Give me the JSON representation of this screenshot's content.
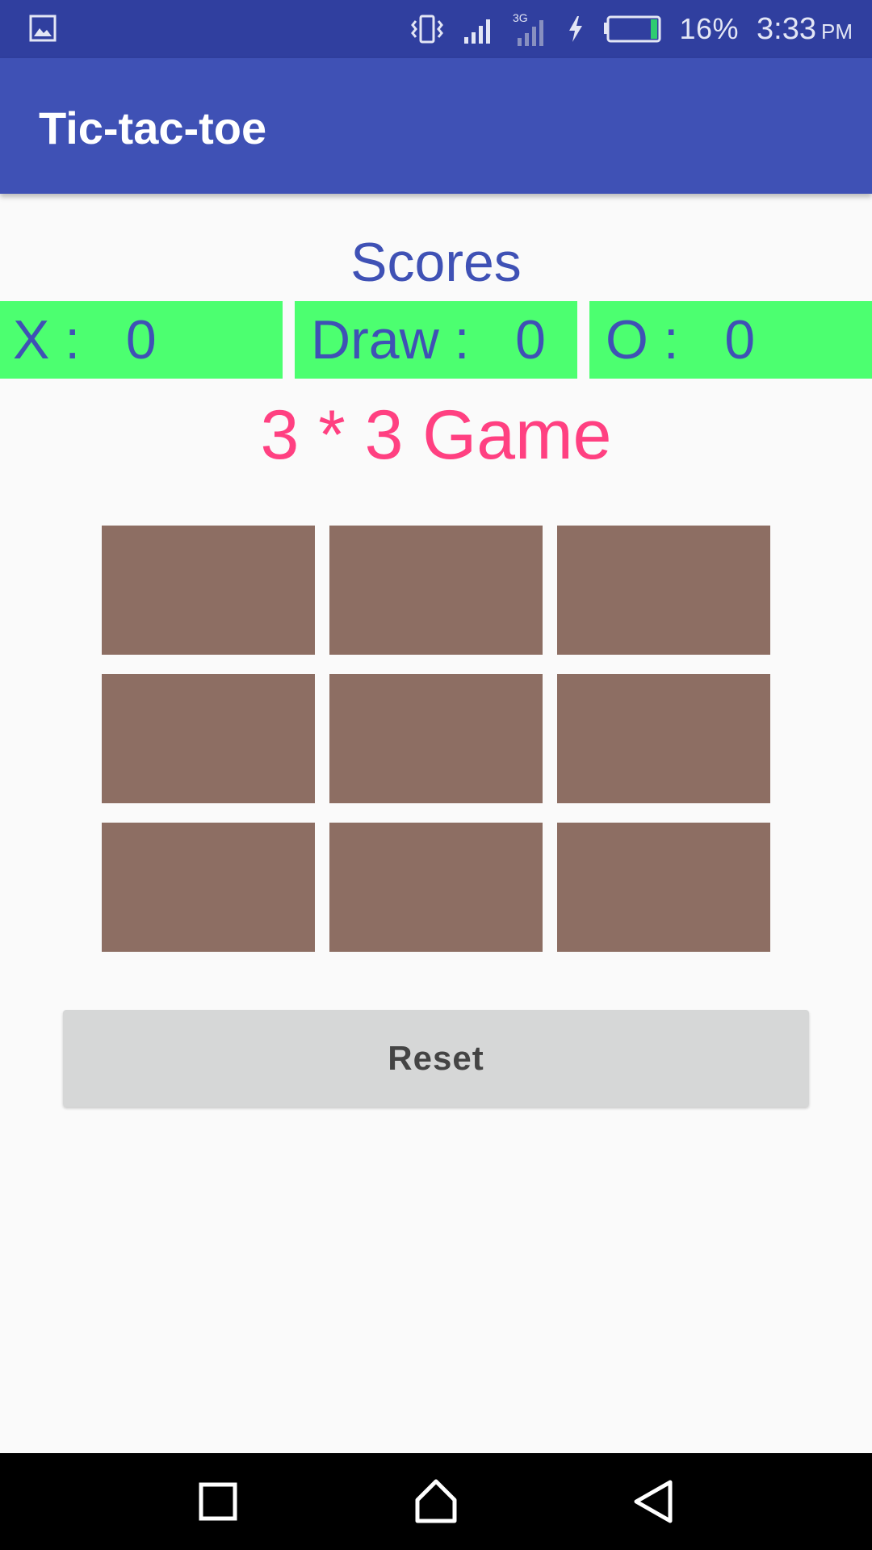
{
  "status_bar": {
    "battery_percent": "16%",
    "time": "3:33",
    "ampm": "PM",
    "network_type": "3G",
    "icons": [
      "gallery-notification-icon",
      "vibrate-icon",
      "signal-icon",
      "signal-3g-icon",
      "charging-icon",
      "battery-icon"
    ]
  },
  "app_bar": {
    "title": "Tic-tac-toe",
    "color": "#3f51b5"
  },
  "scores": {
    "heading": "Scores",
    "x": {
      "label": "X :",
      "value": "0"
    },
    "draw": {
      "label": "Draw :",
      "value": "0"
    },
    "o": {
      "label": "O :",
      "value": "0"
    },
    "box_color": "#4cff70"
  },
  "game": {
    "title": "3 * 3 Game",
    "title_color": "#ff4081",
    "cell_color": "#8d6e63",
    "cells": [
      "",
      "",
      "",
      "",
      "",
      "",
      "",
      "",
      ""
    ]
  },
  "reset_button": {
    "label": "Reset"
  },
  "nav_bar": {
    "icons": [
      "recents-icon",
      "home-icon",
      "back-icon"
    ]
  }
}
